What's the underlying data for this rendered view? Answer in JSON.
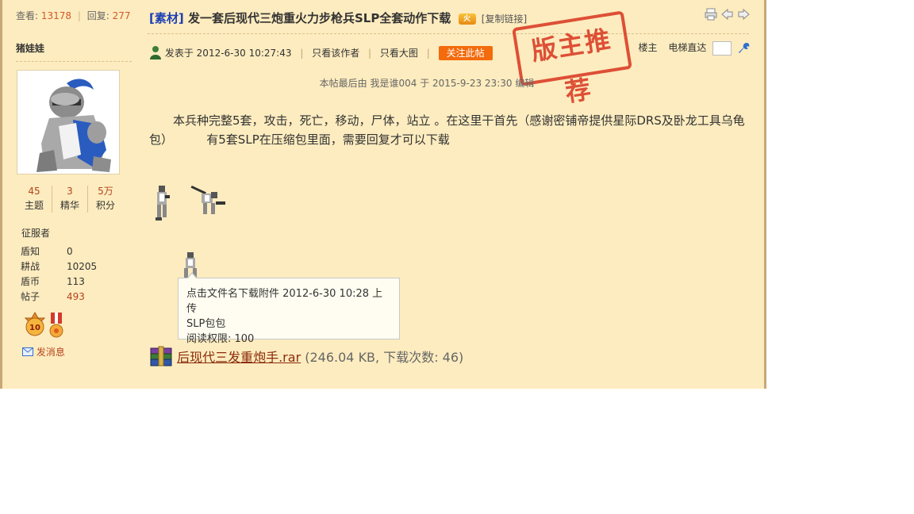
{
  "sidebar": {
    "views_label": "查看:",
    "views_value": "13178",
    "replies_label": "回复:",
    "replies_value": "277",
    "username": "猪娃娃",
    "counts": [
      {
        "value": "45",
        "label": "主题"
      },
      {
        "value": "3",
        "label": "精华"
      },
      {
        "value": "5万",
        "label": "积分"
      }
    ],
    "rank": "征服者",
    "profile": [
      {
        "key": "盾知",
        "value": "0"
      },
      {
        "key": "耕战",
        "value": "10205"
      },
      {
        "key": "盾币",
        "value": "113"
      },
      {
        "key": "帖子",
        "value": "493"
      }
    ],
    "medal_label": "10",
    "send_message": "发消息"
  },
  "post": {
    "title_tag": "[素材]",
    "title": "发一套后现代三炮重火力步枪兵SLP全套动作下载",
    "hot_badge": "火",
    "copy_link": "[复制链接]",
    "posted_label": "发表于",
    "posted_time": "2012-6-30 10:27:43",
    "only_author": "只看该作者",
    "big_image": "只看大图",
    "follow_button": "关注此帖",
    "floor_label": "楼主",
    "jump_label": "电梯直达",
    "stamp_text": "版主推荐",
    "edit_note": "本帖最后由 我是谁004 于 2015-9-23 23:30 编辑",
    "body": "　　本兵种完整5套，攻击，死亡，移动，尸体，站立 。在这里干首先（感谢密铺帝提供星际DRS及卧龙工具乌龟包）　　　 有5套SLP在压缩包里面，需要回复才可以下载"
  },
  "tooltip": {
    "line1": "点击文件名下载附件  2012-6-30 10:28 上传",
    "line2": "SLP包包",
    "line3": "阅读权限: 100"
  },
  "attachment": {
    "filename": "后现代三发重炮手.rar",
    "info": "(246.04 KB, 下载次数: 46)"
  }
}
